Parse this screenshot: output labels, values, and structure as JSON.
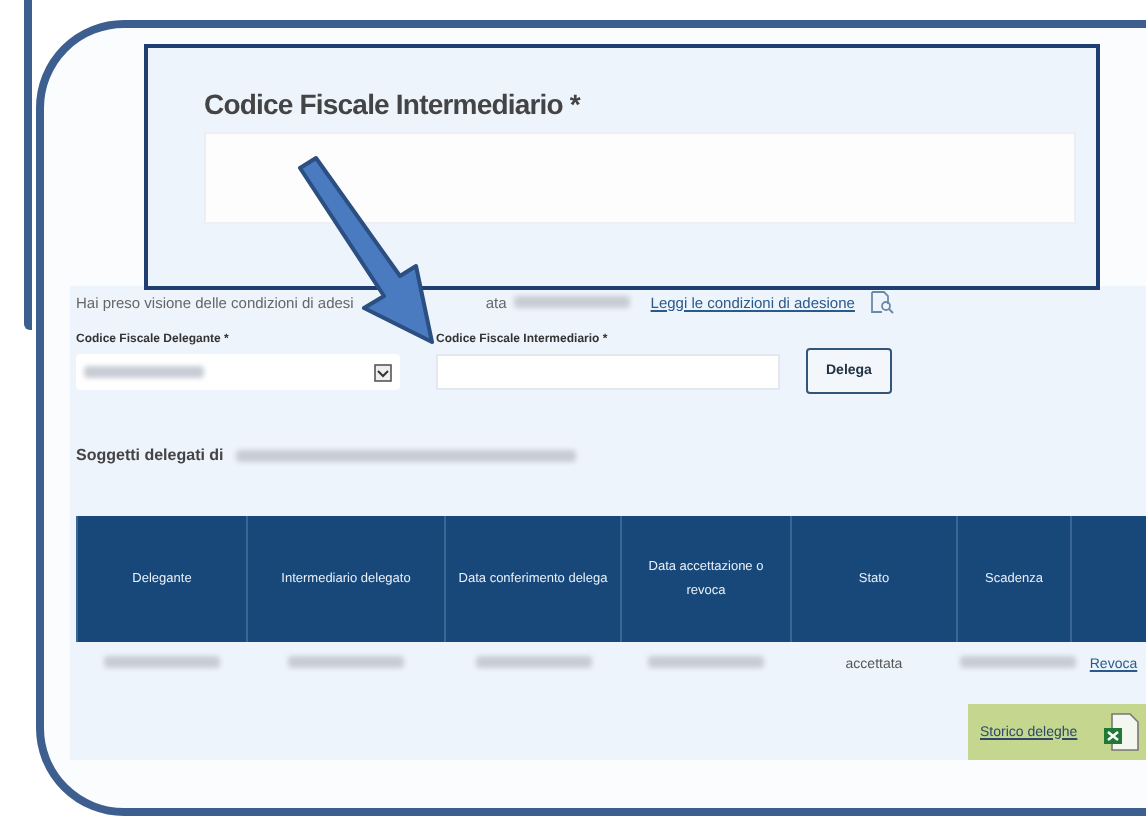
{
  "callout": {
    "label": "Codice Fiscale Intermediario *"
  },
  "consent": {
    "text_before": "Hai preso visione delle condizioni di adesi",
    "text_after": "ata",
    "link": "Leggi le condizioni di adesione"
  },
  "form": {
    "delegante_label": "Codice Fiscale Delegante *",
    "intermediario_label": "Codice Fiscale Intermediario *",
    "button": "Delega"
  },
  "subjects_heading": "Soggetti delegati di",
  "table": {
    "columns": [
      "Delegante",
      "Intermediario delegato",
      "Data conferimento delega",
      "Data accettazione o revoca",
      "Stato",
      "Scadenza"
    ],
    "rows": [
      {
        "cells": [
          {
            "kind": "blurred"
          },
          {
            "kind": "blurred"
          },
          {
            "kind": "blurred"
          },
          {
            "kind": "blurred"
          },
          {
            "kind": "text",
            "text": "accettata"
          },
          {
            "kind": "blurred"
          },
          {
            "kind": "link",
            "text": "Revoca"
          }
        ]
      }
    ]
  },
  "export_button": "Storico deleghe"
}
